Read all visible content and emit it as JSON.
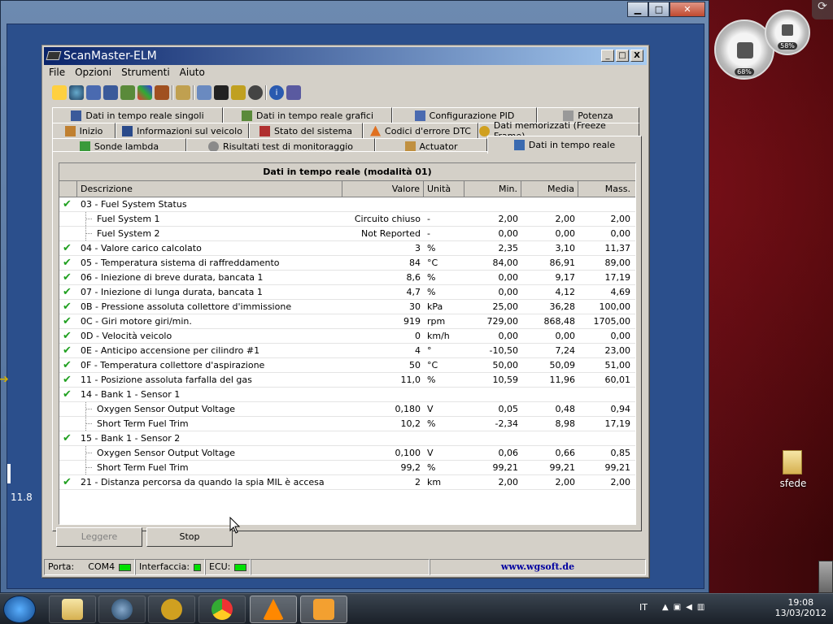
{
  "app": {
    "title": "ScanMaster-ELM",
    "menu": [
      "File",
      "Opzioni",
      "Strumenti",
      "Aiuto"
    ]
  },
  "tabs": {
    "row1": [
      "Dati in tempo reale singoli",
      "Dati in tempo reale grafici",
      "Configurazione PID",
      "Potenza"
    ],
    "row2": [
      "Inizio",
      "Informazioni sul veicolo",
      "Stato del sistema",
      "Codici d'errore DTC",
      "Dati memorizzati (Freeze Frame)"
    ],
    "row3": [
      "Sonde lambda",
      "Risultati test di monitoraggio",
      "Actuator",
      "Dati in tempo reale"
    ]
  },
  "grid": {
    "title": "Dati in tempo reale (modalità 01)",
    "headers": [
      "Descrizione",
      "Valore",
      "Unità",
      "Min.",
      "Media",
      "Mass."
    ],
    "rows": [
      {
        "type": "group",
        "check": true,
        "desc": "03 - Fuel System Status",
        "val": "",
        "unit": "",
        "min": "",
        "avg": "",
        "max": ""
      },
      {
        "type": "sub",
        "desc": "Fuel System 1",
        "val": "Circuito chiuso",
        "unit": "-",
        "min": "2,00",
        "avg": "2,00",
        "max": "2,00"
      },
      {
        "type": "sub",
        "desc": "Fuel System 2",
        "val": "Not Reported",
        "unit": "-",
        "min": "0,00",
        "avg": "0,00",
        "max": "0,00"
      },
      {
        "type": "group",
        "check": true,
        "desc": "04 - Valore carico calcolato",
        "val": "3",
        "unit": "%",
        "min": "2,35",
        "avg": "3,10",
        "max": "11,37"
      },
      {
        "type": "group",
        "check": true,
        "desc": "05 - Temperatura sistema di raffreddamento",
        "val": "84",
        "unit": "°C",
        "min": "84,00",
        "avg": "86,91",
        "max": "89,00"
      },
      {
        "type": "group",
        "check": true,
        "desc": "06 - Iniezione di breve durata, bancata 1",
        "val": "8,6",
        "unit": "%",
        "min": "0,00",
        "avg": "9,17",
        "max": "17,19"
      },
      {
        "type": "group",
        "check": true,
        "desc": "07 - Iniezione di lunga durata, bancata 1",
        "val": "4,7",
        "unit": "%",
        "min": "0,00",
        "avg": "4,12",
        "max": "4,69"
      },
      {
        "type": "group",
        "check": true,
        "desc": "0B - Pressione assoluta collettore d'immissione",
        "val": "30",
        "unit": "kPa",
        "min": "25,00",
        "avg": "36,28",
        "max": "100,00"
      },
      {
        "type": "group",
        "check": true,
        "desc": "0C - Giri motore giri/min.",
        "val": "919",
        "unit": "rpm",
        "min": "729,00",
        "avg": "868,48",
        "max": "1705,00"
      },
      {
        "type": "group",
        "check": true,
        "desc": "0D - Velocità veicolo",
        "val": "0",
        "unit": "km/h",
        "min": "0,00",
        "avg": "0,00",
        "max": "0,00"
      },
      {
        "type": "group",
        "check": true,
        "desc": "0E - Anticipo accensione per cilindro #1",
        "val": "4",
        "unit": "°",
        "min": "-10,50",
        "avg": "7,24",
        "max": "23,00"
      },
      {
        "type": "group",
        "check": true,
        "desc": "0F - Temperatura collettore d'aspirazione",
        "val": "50",
        "unit": "°C",
        "min": "50,00",
        "avg": "50,09",
        "max": "51,00"
      },
      {
        "type": "group",
        "check": true,
        "arrow": true,
        "desc": "11 - Posizione assoluta farfalla del gas",
        "val": "11,0",
        "unit": "%",
        "min": "10,59",
        "avg": "11,96",
        "max": "60,01"
      },
      {
        "type": "group",
        "check": true,
        "desc": "14 - Bank 1 - Sensor 1",
        "val": "",
        "unit": "",
        "min": "",
        "avg": "",
        "max": ""
      },
      {
        "type": "sub",
        "desc": "Oxygen Sensor Output Voltage",
        "val": "0,180",
        "unit": "V",
        "min": "0,05",
        "avg": "0,48",
        "max": "0,94"
      },
      {
        "type": "sub",
        "desc": "Short Term Fuel Trim",
        "val": "10,2",
        "unit": "%",
        "min": "-2,34",
        "avg": "8,98",
        "max": "17,19"
      },
      {
        "type": "group",
        "check": true,
        "desc": "15 - Bank 1 - Sensor 2",
        "val": "",
        "unit": "",
        "min": "",
        "avg": "",
        "max": ""
      },
      {
        "type": "sub",
        "desc": "Oxygen Sensor Output Voltage",
        "val": "0,100",
        "unit": "V",
        "min": "0,06",
        "avg": "0,66",
        "max": "0,85"
      },
      {
        "type": "sub",
        "desc": "Short Term Fuel Trim",
        "val": "99,2",
        "unit": "%",
        "min": "99,21",
        "avg": "99,21",
        "max": "99,21"
      },
      {
        "type": "group",
        "check": true,
        "desc": "21 - Distanza percorsa da quando la spia MIL è accesa",
        "val": "2",
        "unit": "km",
        "min": "2,00",
        "avg": "2,00",
        "max": "2,00"
      }
    ]
  },
  "buttons": {
    "read": "Leggere",
    "stop": "Stop"
  },
  "status": {
    "port_label": "Porta:",
    "port": "COM4",
    "iface": "Interfaccia:",
    "ecu": "ECU:",
    "link": "www.wgsoft.de"
  },
  "desktop": {
    "folder": "sfede",
    "side_text": "11.8",
    "gauge1": "68%",
    "gauge2": "58%"
  },
  "taskbar": {
    "lang": "IT",
    "time": "19:08",
    "date": "13/03/2012"
  }
}
